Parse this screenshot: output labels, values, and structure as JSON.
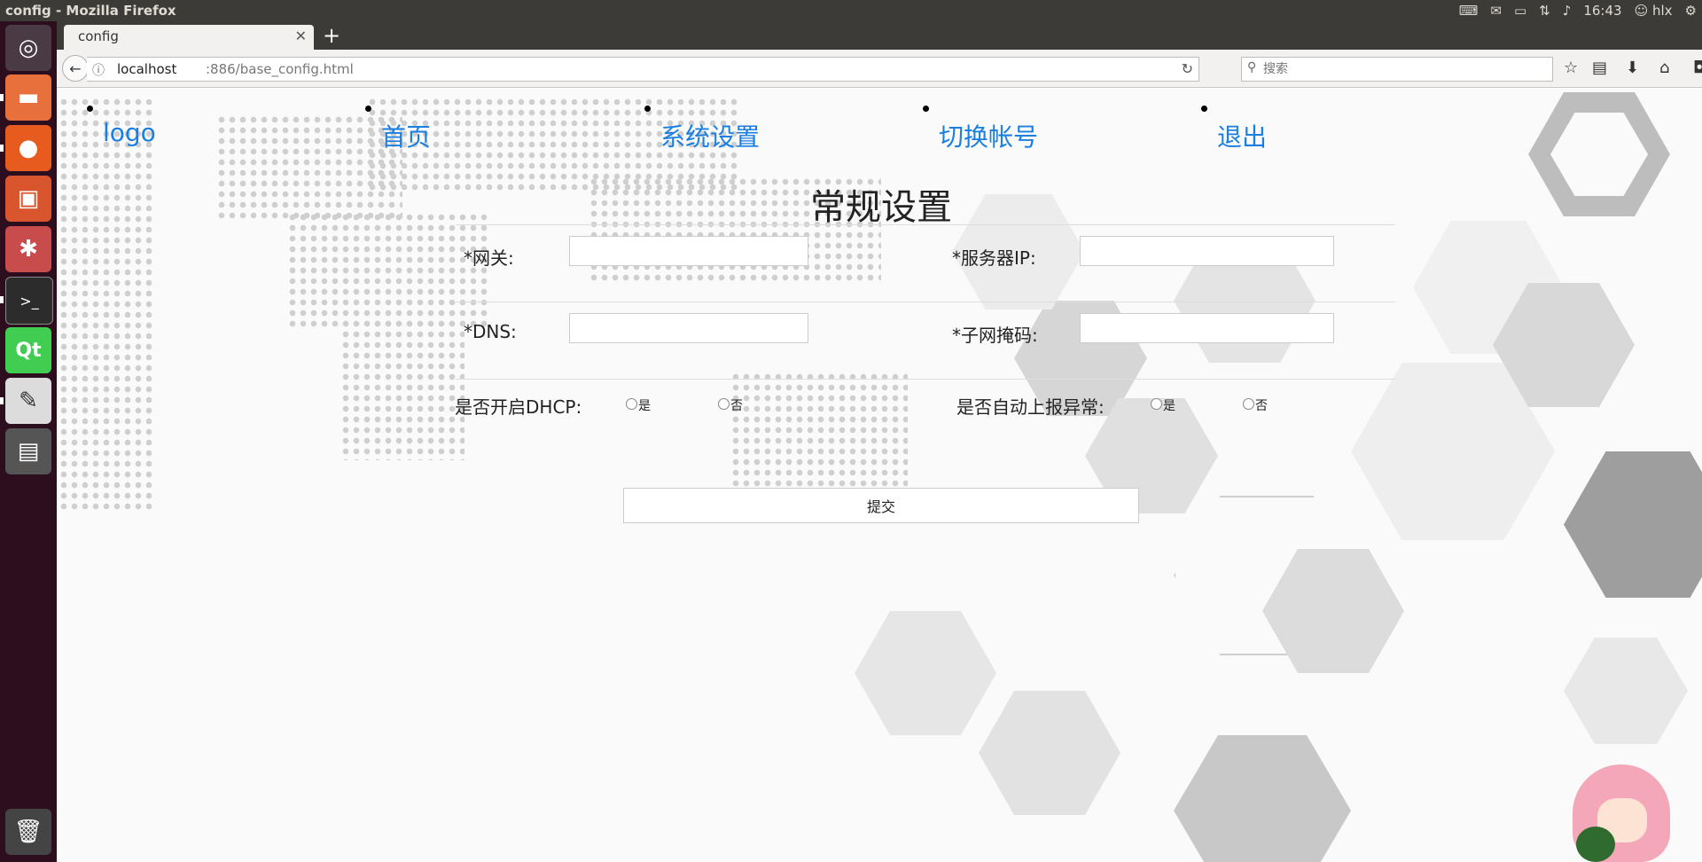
{
  "system": {
    "window_title": "config - Mozilla Firefox",
    "clock": "16:43",
    "user": "hlx"
  },
  "browser": {
    "tab_title": "config",
    "url_host": "localhost",
    "url_path": ":886/base_config.html",
    "search_placeholder": "搜索"
  },
  "nav": {
    "items": [
      "logo",
      "首页",
      "系统设置",
      "切换帐号",
      "退出"
    ]
  },
  "page": {
    "title": "常规设置"
  },
  "form": {
    "gateway_label": "*网关:",
    "server_ip_label": "*服务器IP:",
    "dns_label": "*DNS:",
    "subnet_label": "*子网掩码:",
    "dhcp_label": "是否开启DHCP:",
    "auto_report_label": "是否自动上报异常:",
    "yes": "是",
    "no": "否",
    "submit": "提交"
  },
  "colors": {
    "link": "#1a7fe0",
    "launcher": "#2c0e1e",
    "panel": "#3c3b37"
  },
  "icons": {
    "launcher": [
      "ubuntu-dash-icon",
      "files-icon",
      "firefox-icon",
      "software-center-icon",
      "system-settings-icon",
      "terminal-icon",
      "qt-creator-icon",
      "text-editor-icon",
      "workspace-switcher-icon",
      "trash-icon"
    ]
  }
}
